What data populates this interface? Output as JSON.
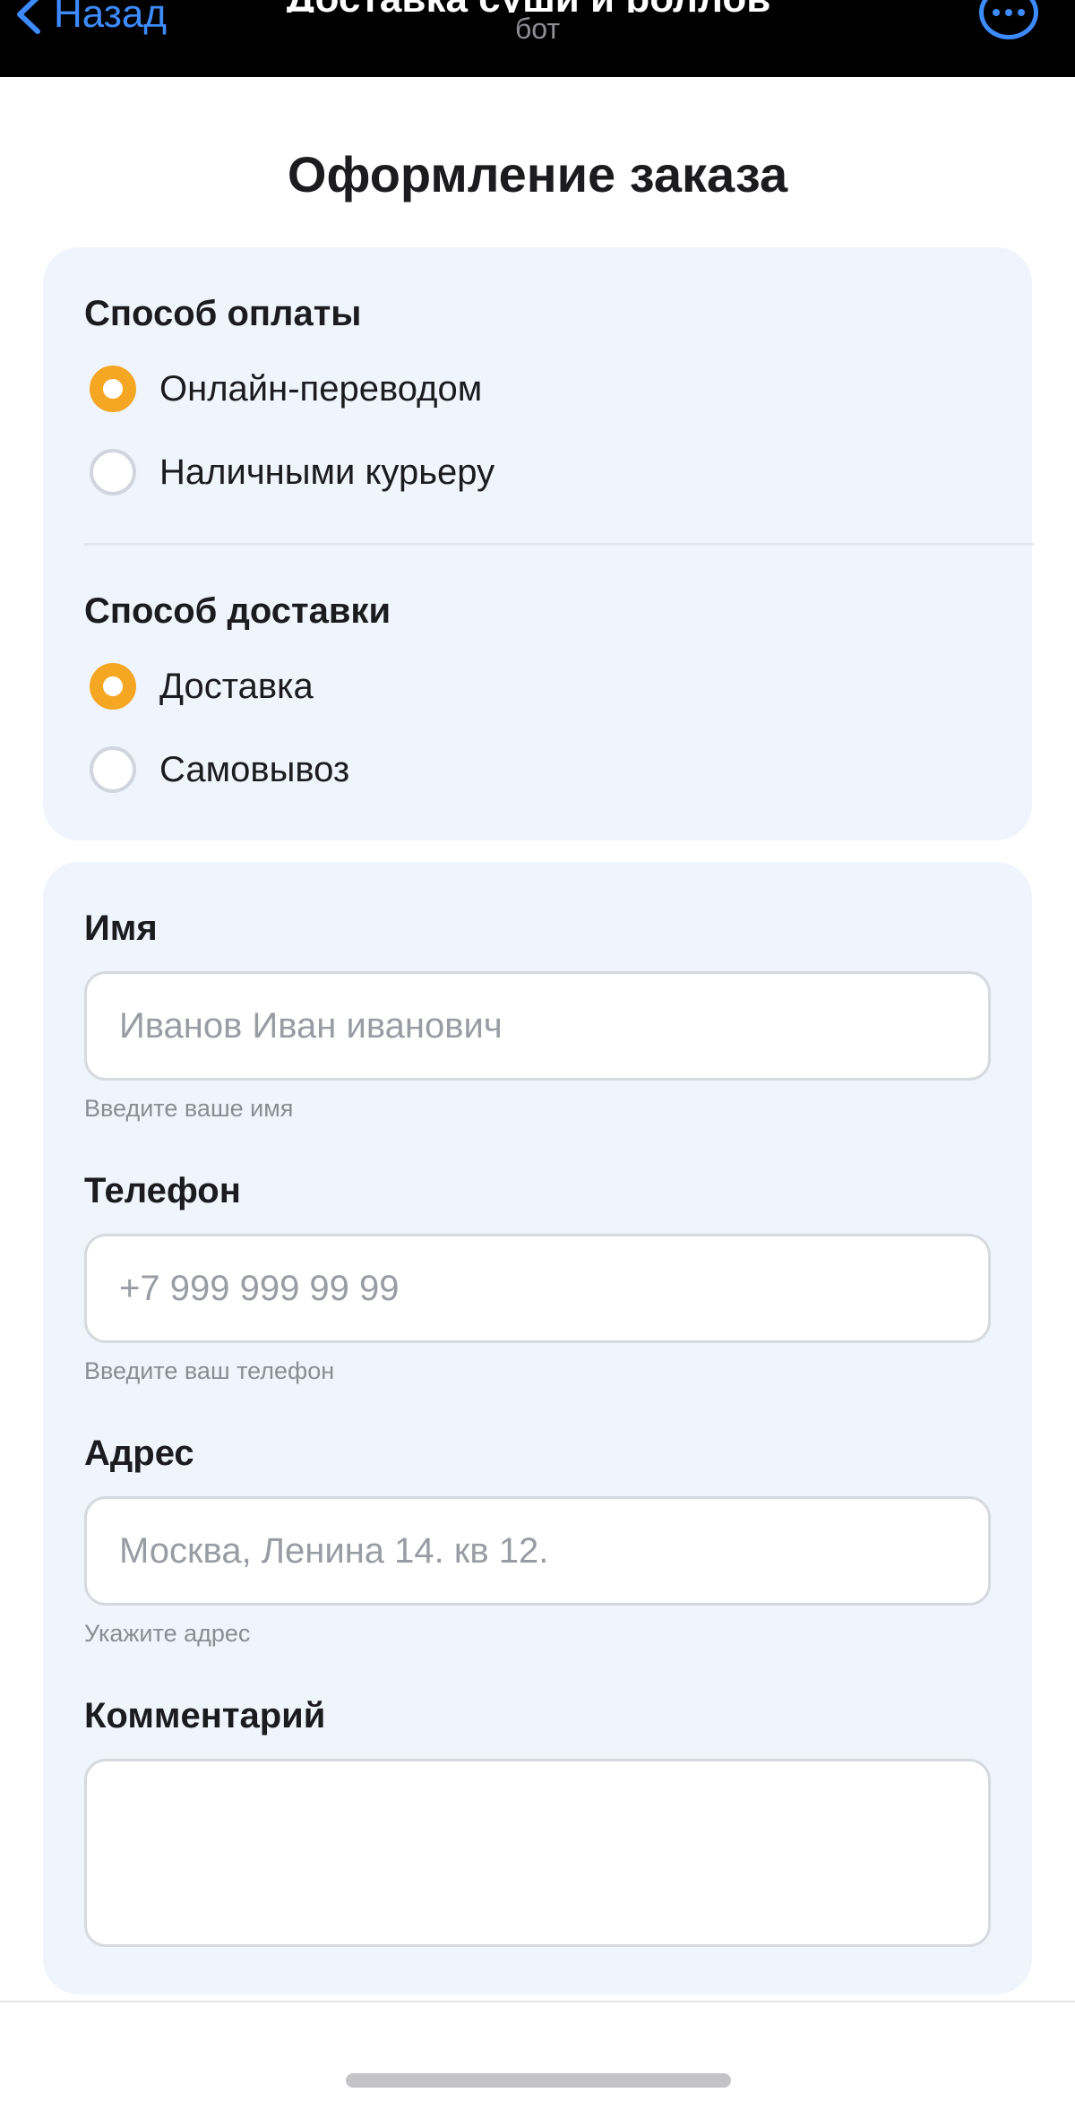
{
  "nav": {
    "back_label": "Назад",
    "bot_title": "Доставка суши и роллов",
    "bot_subtitle": "бот",
    "accent_color": "#3d8bff"
  },
  "page_title": "Оформление заказа",
  "payment": {
    "title": "Способ оплаты",
    "options": [
      {
        "label": "Онлайн-переводом",
        "selected": true
      },
      {
        "label": "Наличными курьеру",
        "selected": false
      }
    ]
  },
  "delivery": {
    "title": "Способ доставки",
    "options": [
      {
        "label": "Доставка",
        "selected": true
      },
      {
        "label": "Самовывоз",
        "selected": false
      }
    ]
  },
  "form": {
    "name": {
      "label": "Имя",
      "placeholder": "Иванов Иван иванович",
      "value": "",
      "hint": "Введите ваше имя"
    },
    "phone": {
      "label": "Телефон",
      "placeholder": "+7 999 999 99 99",
      "value": "",
      "hint": "Введите ваш телефон"
    },
    "address": {
      "label": "Адрес",
      "placeholder": "Москва, Ленина 14. кв 12.",
      "value": "",
      "hint": "Укажите адрес"
    },
    "comment": {
      "label": "Комментарий",
      "placeholder": "",
      "value": ""
    }
  },
  "colors": {
    "radio_selected": "#f5a623",
    "card_background": "#eff4fd"
  }
}
